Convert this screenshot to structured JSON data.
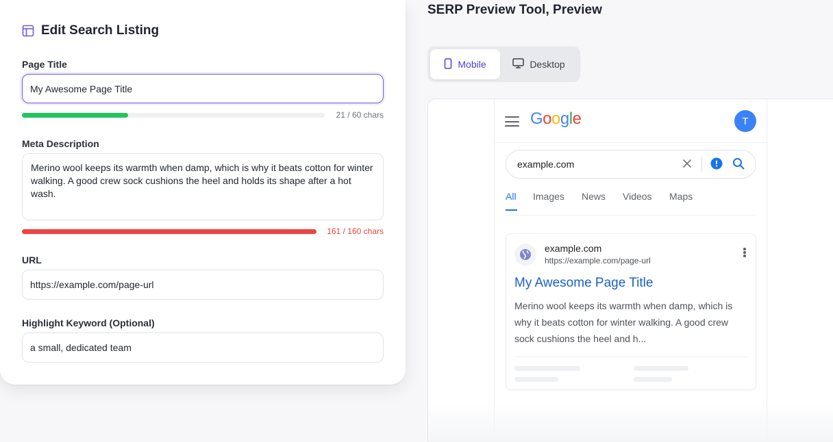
{
  "editor": {
    "title": "Edit Search Listing",
    "page_title": {
      "label": "Page Title",
      "value": "My Awesome Page Title",
      "count_text": "21 / 60 chars",
      "fill_fraction": 0.35,
      "color": "#22c55e"
    },
    "meta_description": {
      "label": "Meta Description",
      "value": "Merino wool keeps its warmth when damp, which is why it beats cotton for winter walking. A good crew sock cushions the heel and holds its shape after a hot wash.",
      "count_text": "161 / 160 chars",
      "fill_fraction": 1.0,
      "color": "#ef4444"
    },
    "url": {
      "label": "URL",
      "value": "https://example.com/page-url"
    },
    "keyword": {
      "label": "Highlight Keyword (Optional)",
      "value": "a small, dedicated team"
    }
  },
  "preview": {
    "heading": "SERP Preview Tool, Preview",
    "toggle": {
      "mobile_label": "Mobile",
      "desktop_label": "Desktop",
      "selected": "Mobile"
    },
    "google": {
      "logo_letters": [
        {
          "ch": "G",
          "color": "#4285F4"
        },
        {
          "ch": "o",
          "color": "#EA4335"
        },
        {
          "ch": "o",
          "color": "#FBBC05"
        },
        {
          "ch": "g",
          "color": "#4285F4"
        },
        {
          "ch": "l",
          "color": "#34A853"
        },
        {
          "ch": "e",
          "color": "#EA4335"
        }
      ],
      "avatar_initial": "T",
      "search_query": "example.com",
      "tabs": [
        "All",
        "Images",
        "News",
        "Videos",
        "Maps"
      ],
      "active_tab": "All"
    },
    "result": {
      "site_name": "example.com",
      "site_url": "https://example.com/page-url",
      "title": "My Awesome Page Title",
      "description": "Merino wool keeps its warmth when damp, which is why it beats cotton for winter walking. A good crew sock cushions the heel and h..."
    }
  },
  "colors": {
    "accent": "#6d5ae6",
    "link": "#1a60c9",
    "google_blue": "#1a73e8"
  },
  "icons": [
    "layout-icon",
    "phone-icon",
    "monitor-icon",
    "menu-icon",
    "clear-icon",
    "lens-icon",
    "search-icon",
    "globe-icon",
    "more-vert-icon"
  ]
}
